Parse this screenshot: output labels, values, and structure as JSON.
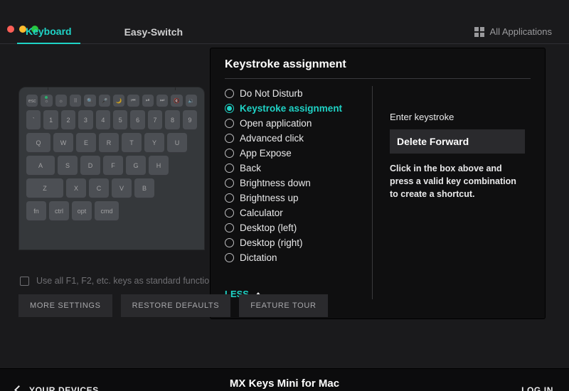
{
  "tabs": {
    "keyboard": "Keyboard",
    "easy_switch": "Easy-Switch"
  },
  "all_apps_label": "All Applications",
  "panel": {
    "title": "Keystroke assignment",
    "options": [
      "Do Not Disturb",
      "Keystroke assignment",
      "Open application",
      "Advanced click",
      "App Expose",
      "Back",
      "Brightness down",
      "Brightness up",
      "Calculator",
      "Desktop (left)",
      "Desktop (right)",
      "Dictation"
    ],
    "selected_index": 1,
    "less_label": "LESS",
    "detail": {
      "label": "Enter keystroke",
      "value": "Delete Forward",
      "hint": "Click in the box above and press a valid key combination to create a shortcut."
    }
  },
  "std_fn_label": "Use all F1, F2, etc. keys as standard functio",
  "buttons": {
    "more": "MORE SETTINGS",
    "restore": "RESTORE DEFAULTS",
    "tour": "FEATURE TOUR"
  },
  "footer": {
    "your_devices": "YOUR DEVICES",
    "device_name": "MX Keys Mini for Mac",
    "login": "LOG IN"
  },
  "kbd_rows": {
    "fn": [
      "esc",
      "☼",
      "☼",
      "⠿",
      "🔍",
      "🎤",
      "🌙",
      "⏮",
      "⏯",
      "⏭",
      "🔇",
      "🔉"
    ],
    "num": [
      "`",
      "1",
      "2",
      "3",
      "4",
      "5",
      "6",
      "7",
      "8",
      "9"
    ],
    "q": [
      "Q",
      "W",
      "E",
      "R",
      "T",
      "Y",
      "U"
    ],
    "a": [
      "A",
      "S",
      "D",
      "F",
      "G",
      "H"
    ],
    "z": [
      "Z",
      "X",
      "C",
      "V",
      "B"
    ],
    "mod": [
      "fn",
      "ctrl",
      "opt",
      "cmd"
    ]
  }
}
